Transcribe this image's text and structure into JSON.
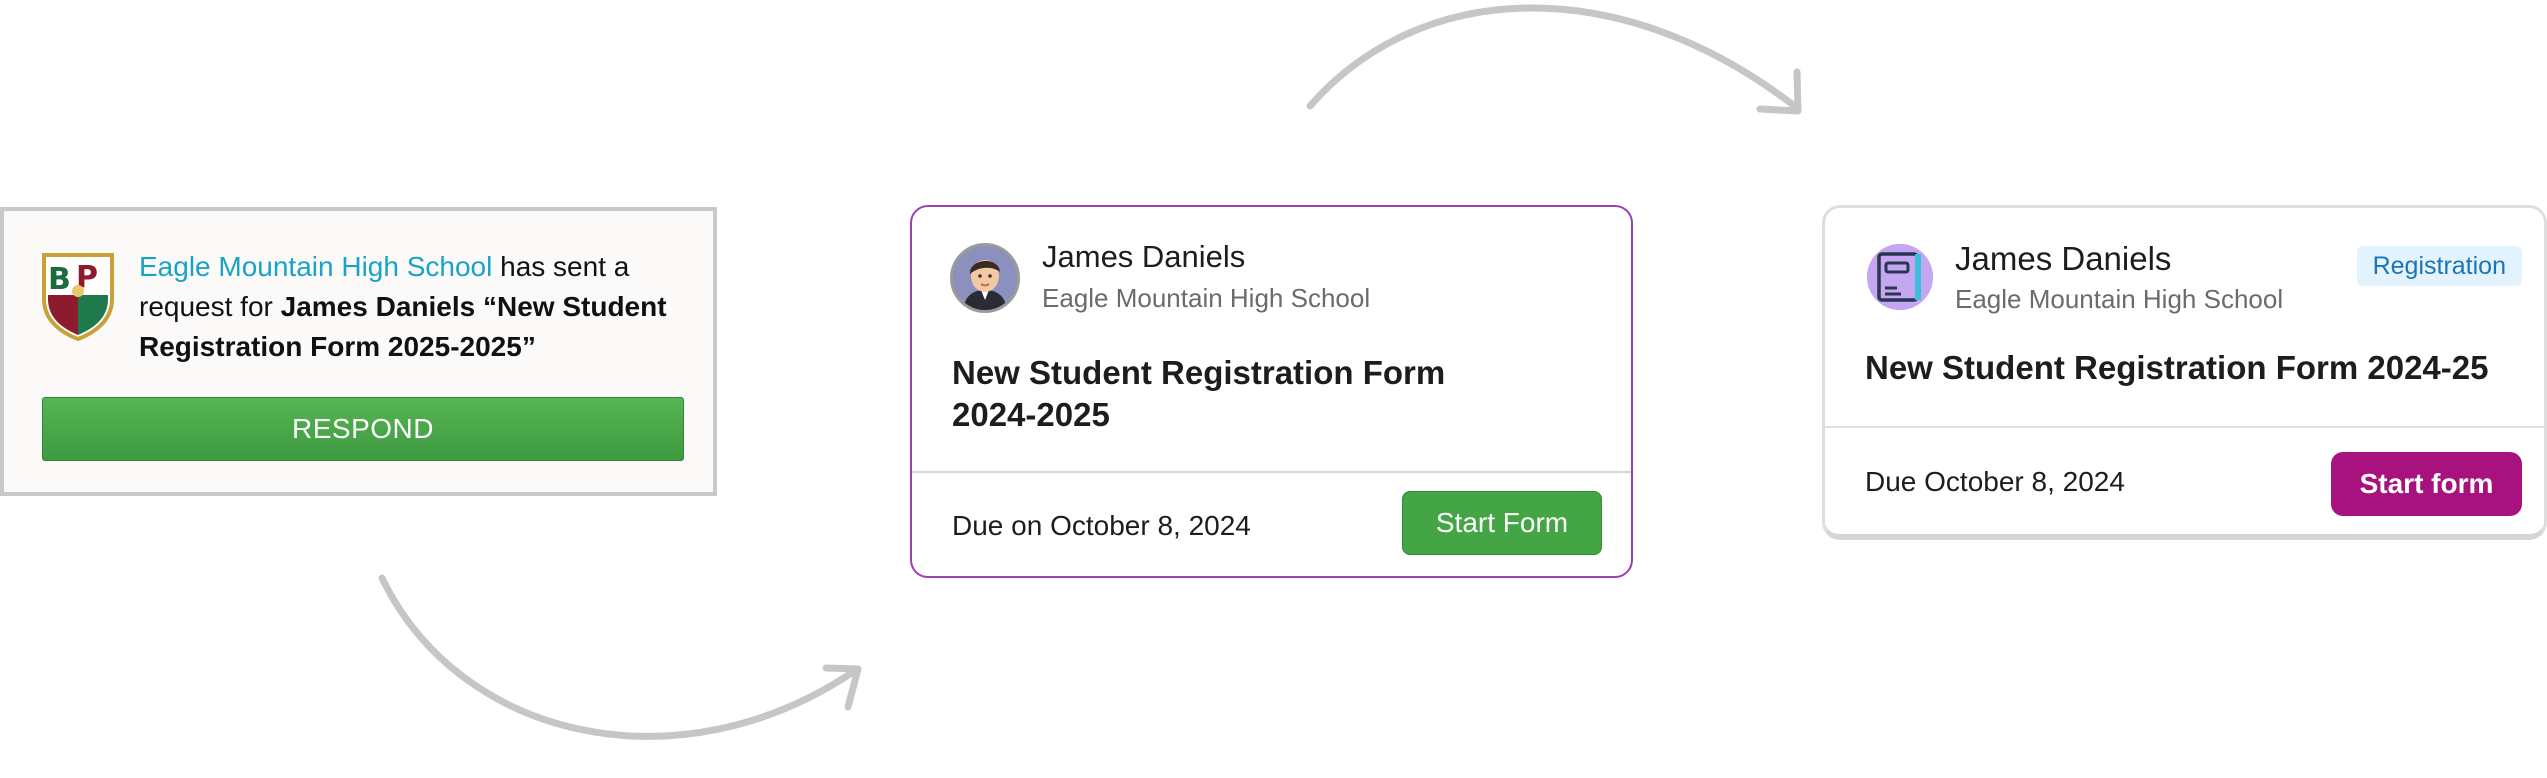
{
  "card1": {
    "school": "Eagle Mountain High School",
    "msg_mid": " has sent a request for ",
    "form_name": "James Daniels “New Student Registration Form 2025-2025”",
    "respond_label": "RESPOND",
    "crest_letters": "BP"
  },
  "card2": {
    "name": "James Daniels",
    "school": "Eagle Mountain High School",
    "title": "New Student Registration Form 2024-2025",
    "due": "Due on October 8, 2024",
    "start_label": "Start Form"
  },
  "card3": {
    "name": "James Daniels",
    "school": "Eagle Mountain High School",
    "badge": "Registration",
    "title": "New Student Registration Form 2024-25",
    "due": "Due October 8, 2024",
    "start_label": "Start form"
  },
  "colors": {
    "green": "#43a543",
    "purple_border": "#9c3fb0",
    "magenta_button": "#a8127f",
    "link_blue": "#1aa3c8"
  }
}
